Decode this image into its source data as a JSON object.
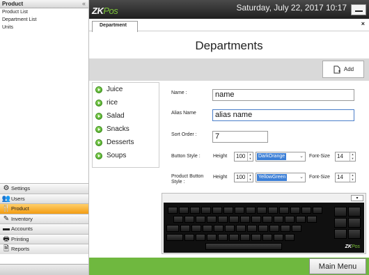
{
  "sidebar": {
    "header": "Product",
    "collapse_glyph": "«",
    "links": [
      "Product List",
      "Department List",
      "Units"
    ],
    "nav": [
      {
        "label": "Settings",
        "icon": "settings-icon",
        "glyph": "⚙"
      },
      {
        "label": "Users",
        "icon": "users-icon",
        "glyph": "👥"
      },
      {
        "label": "Product",
        "icon": "product-icon",
        "glyph": "🍴"
      },
      {
        "label": "Inventory",
        "icon": "inventory-icon",
        "glyph": "✎"
      },
      {
        "label": "Accounts",
        "icon": "accounts-icon",
        "glyph": "▬"
      },
      {
        "label": "Printing",
        "icon": "printer-icon",
        "glyph": "🖶"
      },
      {
        "label": "Reports",
        "icon": "reports-icon",
        "glyph": "🗎"
      }
    ],
    "active_nav": "Product"
  },
  "topbar": {
    "logo_main": "ZK",
    "logo_sub": "Pos",
    "datetime": "Saturday, July 22, 2017 10:17"
  },
  "tabs": {
    "active": "Department",
    "close_glyph": "×"
  },
  "page": {
    "title": "Departments",
    "add_label": "Add"
  },
  "departments": [
    "Juice",
    "rice",
    "Salad",
    "Snacks",
    "Desserts",
    "Soups"
  ],
  "form": {
    "name_label": "Name :",
    "name_value": "name",
    "alias_label": "Alias Name",
    "alias_value": "alias name",
    "sort_label": "Sort Order :",
    "sort_value": "7",
    "button_style_label": "Button Style :",
    "product_button_style_label": "Product Button Style :",
    "height_label": "Height",
    "font_size_label": "Font-Size",
    "button_height": "100",
    "button_color": "DarkOrange",
    "button_color_hex": "#ff8c00",
    "button_font_size": "14",
    "product_height": "100",
    "product_color": "YellowGreen",
    "product_color_hex": "#9acd32",
    "product_font_size": "14"
  },
  "keyboard": {
    "toggle_glyph": "▾",
    "logo_main": "ZK",
    "logo_sub": "Pos"
  },
  "footer": {
    "main_menu_label": "Main Menu"
  },
  "colors": {
    "accent_green": "#6fb83f",
    "active_nav": "#f39c12",
    "topbar": "#2b2b2b"
  }
}
